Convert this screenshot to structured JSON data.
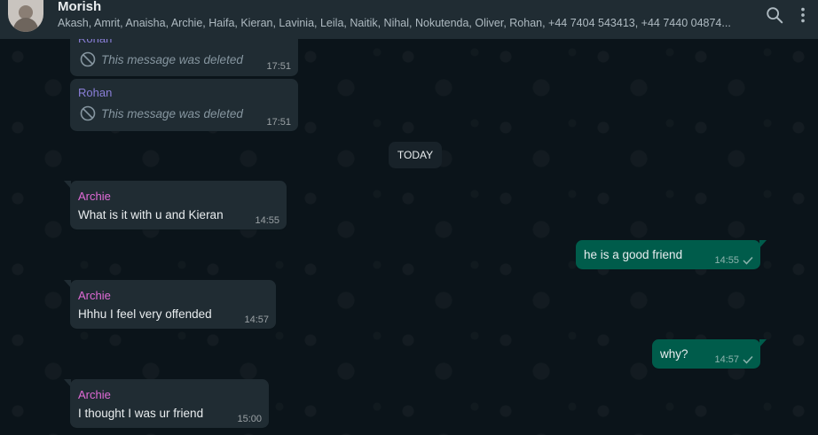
{
  "header": {
    "group_name": "Morish",
    "members": "Akash, Amrit, Anaisha, Archie, Haifa, Kieran, Lavinia, Leila, Naitik, Nihal, Nokutenda, Oliver, Rohan, +44 7404 543413, +44 7440 04874..."
  },
  "date_divider": "TODAY",
  "messages": [
    {
      "sender": "Rohan",
      "text": "This message was deleted",
      "time": "17:51",
      "deleted": true
    },
    {
      "sender": "Rohan",
      "text": "This message was deleted",
      "time": "17:51",
      "deleted": true
    },
    {
      "sender": "Archie",
      "text": "What is it with u and Kieran",
      "time": "14:55"
    },
    {
      "text": "he is a good friend",
      "time": "14:55",
      "outgoing": true
    },
    {
      "sender": "Archie",
      "text": "Hhhu I feel very offended",
      "time": "14:57"
    },
    {
      "text": "why?",
      "time": "14:57",
      "outgoing": true
    },
    {
      "sender": "Archie",
      "text": "I thought I was ur friend",
      "time": "15:00"
    }
  ],
  "colors": {
    "rohan": "#8a7fd8",
    "archie": "#e06ad6",
    "incoming_bubble": "#202c33",
    "outgoing_bubble": "#005c4b",
    "header": "#202c33"
  }
}
